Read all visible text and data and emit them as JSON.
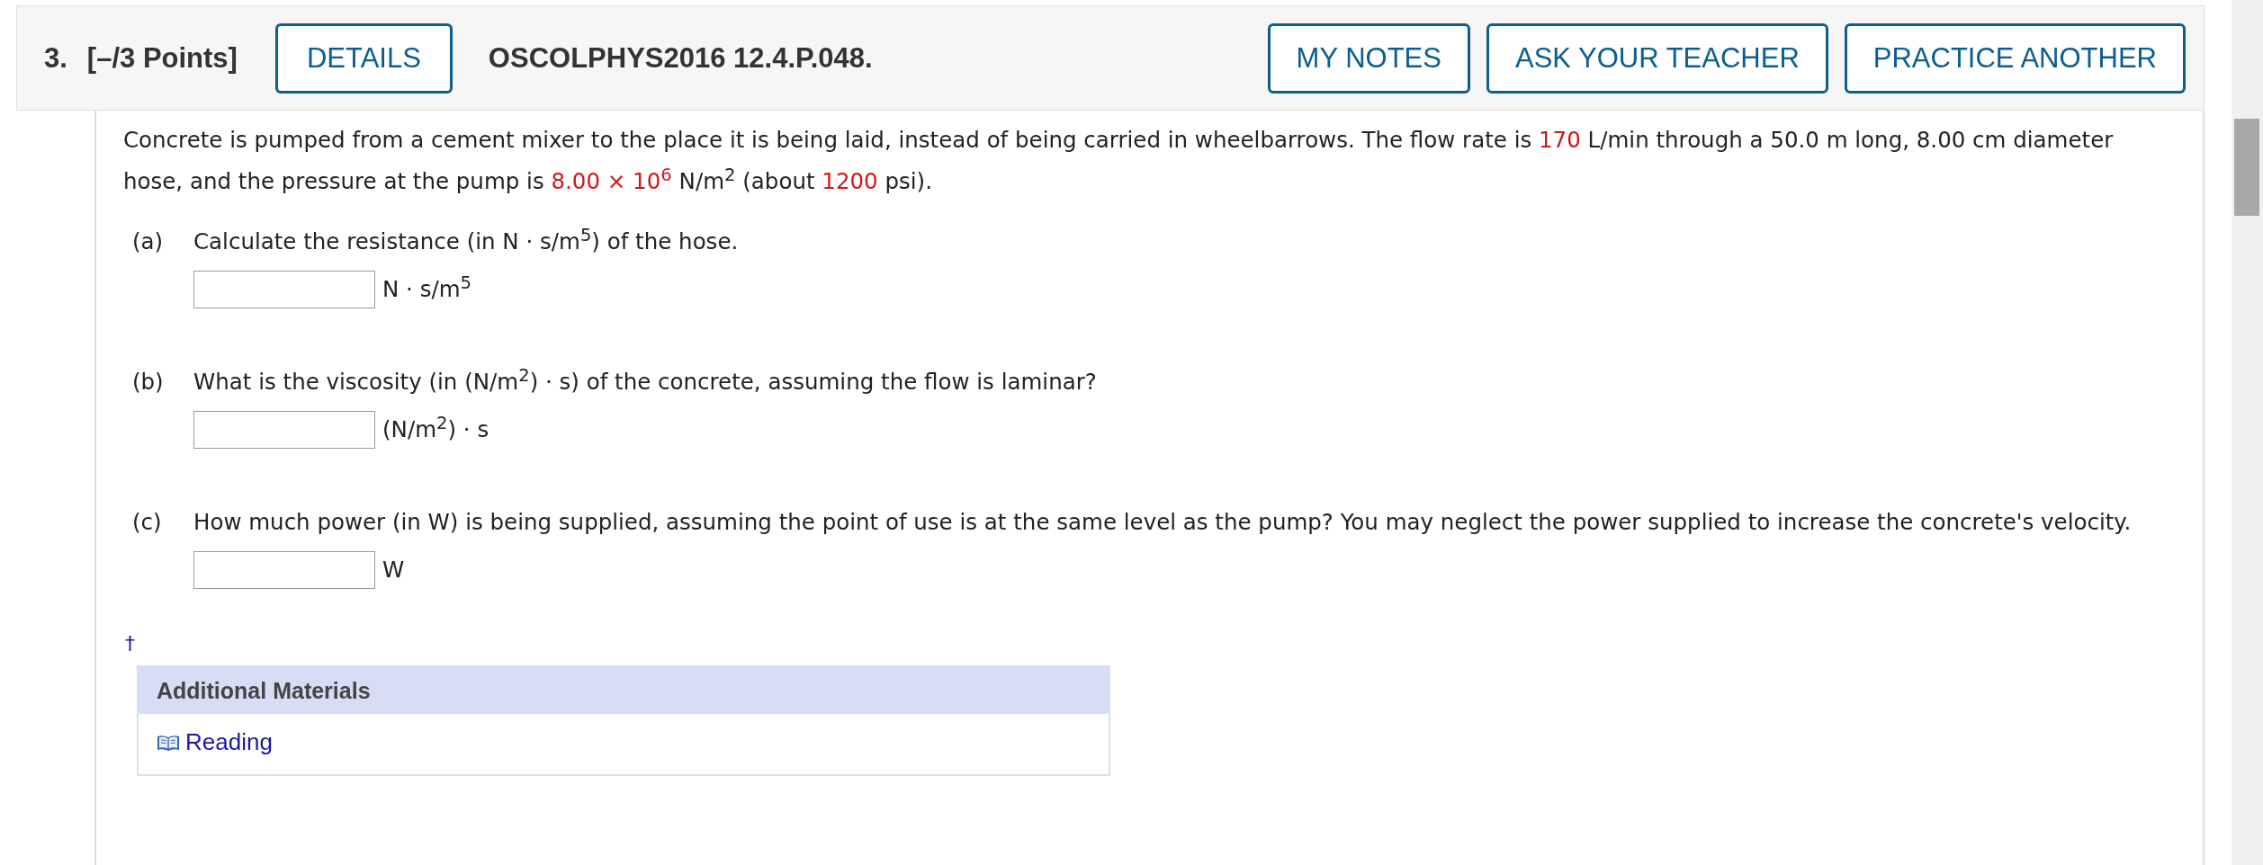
{
  "question": {
    "number": "3.",
    "points": "[–/3 Points]",
    "details_button": "DETAILS",
    "code": "OSCOLPHYS2016 12.4.P.048.",
    "buttons": [
      "MY NOTES",
      "ASK YOUR TEACHER",
      "PRACTICE ANOTHER"
    ]
  },
  "prompt": [
    {
      "kind": "plain",
      "text": "Concrete is pumped from a cement mixer to the place it is being laid, instead of being carried in wheelbarrows. The flow rate is "
    },
    {
      "kind": "value",
      "text": "170"
    },
    {
      "kind": "plain",
      "text": " L/min through a 50.0 m long, 8.00 cm diameter hose, and the pressure at the pump is "
    },
    {
      "kind": "value",
      "text": "8.00 × 10$^{6}$"
    },
    {
      "kind": "plain",
      "text": " N/m$^{2}$ (about "
    },
    {
      "kind": "value",
      "text": "1200"
    },
    {
      "kind": "plain",
      "text": " psi)."
    }
  ],
  "parts": [
    {
      "label": "(a)",
      "question": "Calculate the resistance (in N · s/m$^{5}$) of the hose.",
      "unit": "N · s/m$^{5}$"
    },
    {
      "label": "(b)",
      "question": "What is the viscosity (in (N/m$^{2}$) · s) of the concrete, assuming the flow is laminar?",
      "unit": "(N/m$^{2}$) · s"
    },
    {
      "label": "(c)",
      "question": "How much power (in W) is being supplied, assuming the point of use is at the same level as the pump? You may neglect the power supplied to increase the concrete's velocity.",
      "unit": "W"
    }
  ],
  "footnote_mark": "†",
  "additional_materials": {
    "title": "Additional Materials",
    "links": [
      "Reading"
    ]
  }
}
